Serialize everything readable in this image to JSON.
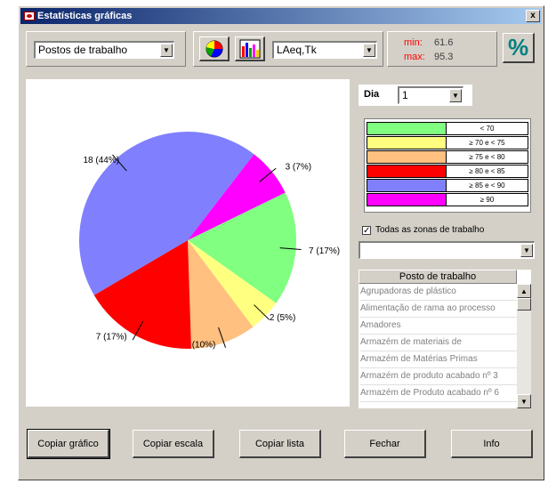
{
  "window": {
    "title": "Estatísticas gráficas",
    "close": "x"
  },
  "toolbar": {
    "group_select": "Postos de trabalho",
    "metric_select": "LAeq,Tk",
    "min_label": "min:",
    "min_value": "61.6",
    "max_label": "max:",
    "max_value": "95.3",
    "percent_label": "%"
  },
  "day": {
    "label": "Dia",
    "value": "1"
  },
  "chart_data": {
    "type": "pie",
    "slices": [
      {
        "label": "7 (17%)",
        "value": 7,
        "color": "#80ff80"
      },
      {
        "label": "2 (5%)",
        "value": 2,
        "color": "#ffff80"
      },
      {
        "label": "4 (10%)",
        "value": 4,
        "color": "#ffc080"
      },
      {
        "label": "7 (17%)",
        "value": 7,
        "color": "#ff0000"
      },
      {
        "label": "18 (44%)",
        "value": 18,
        "color": "#8080ff"
      },
      {
        "label": "3 (7%)",
        "value": 3,
        "color": "#ff00ff"
      }
    ]
  },
  "legend": [
    {
      "label": "< 70",
      "color": "#80ff80"
    },
    {
      "label": "≥ 70 e < 75",
      "color": "#ffff80"
    },
    {
      "label": "≥ 75 e < 80",
      "color": "#ffc080"
    },
    {
      "label": "≥ 80 e < 85",
      "color": "#ff0000"
    },
    {
      "label": "≥ 85 e < 90",
      "color": "#8080ff"
    },
    {
      "label": "≥ 90",
      "color": "#ff00ff"
    }
  ],
  "zones": {
    "checkbox_label": "Todas as zonas de trabalho",
    "checked": true,
    "select_value": ""
  },
  "list": {
    "header": "Posto de trabalho",
    "items": [
      "Agrupadoras de plástico",
      "Alimentação de rama ao processo",
      "Amadores",
      "Armazém de materiais de",
      "Armazém de Matérias Primas",
      "Armazém de produto acabado nº 3",
      "Armazém de Produto acabado nº 6"
    ]
  },
  "buttons": {
    "copy_chart": "Copiar gráfico",
    "copy_scale": "Copiar escala",
    "copy_list": "Copiar lista",
    "close": "Fechar",
    "info": "Info"
  }
}
